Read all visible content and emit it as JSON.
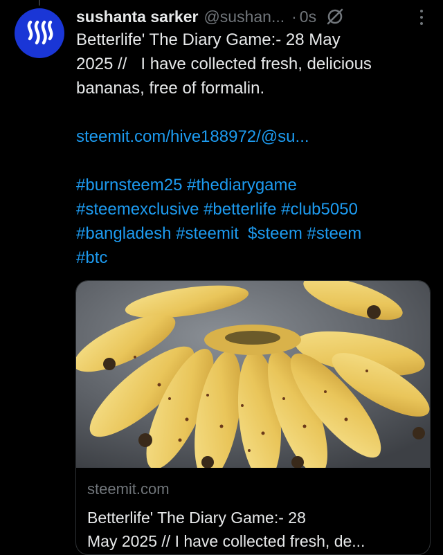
{
  "post": {
    "author_name": "sushanta sarker",
    "author_handle": "@sushan...",
    "separator": "·",
    "time": "0s",
    "text_lines": [
      "Betterlife' The Diary Game:- 28 May",
      "2025 //   I have collected fresh, delicious",
      "bananas, free of formalin."
    ],
    "link": "steemit.com/hive188972/@su...",
    "hashtag_lines": [
      "#burnsteem25 #thediarygame",
      "#steemexclusive #betterlife #club5050",
      "#bangladesh #steemit  $steem #steem",
      "#btc"
    ]
  },
  "card": {
    "domain": "steemit.com",
    "title_lines": [
      "Betterlife' The Diary Game:- 28",
      "May 2025 // I have collected fresh, de..."
    ]
  },
  "colors": {
    "background": "#000000",
    "text": "#e7e9ea",
    "muted": "#71767b",
    "link": "#1d9bf0",
    "avatar": "#1a36d6"
  },
  "icons": [
    "steem-logo-icon",
    "grok-icon",
    "more-options-icon"
  ]
}
